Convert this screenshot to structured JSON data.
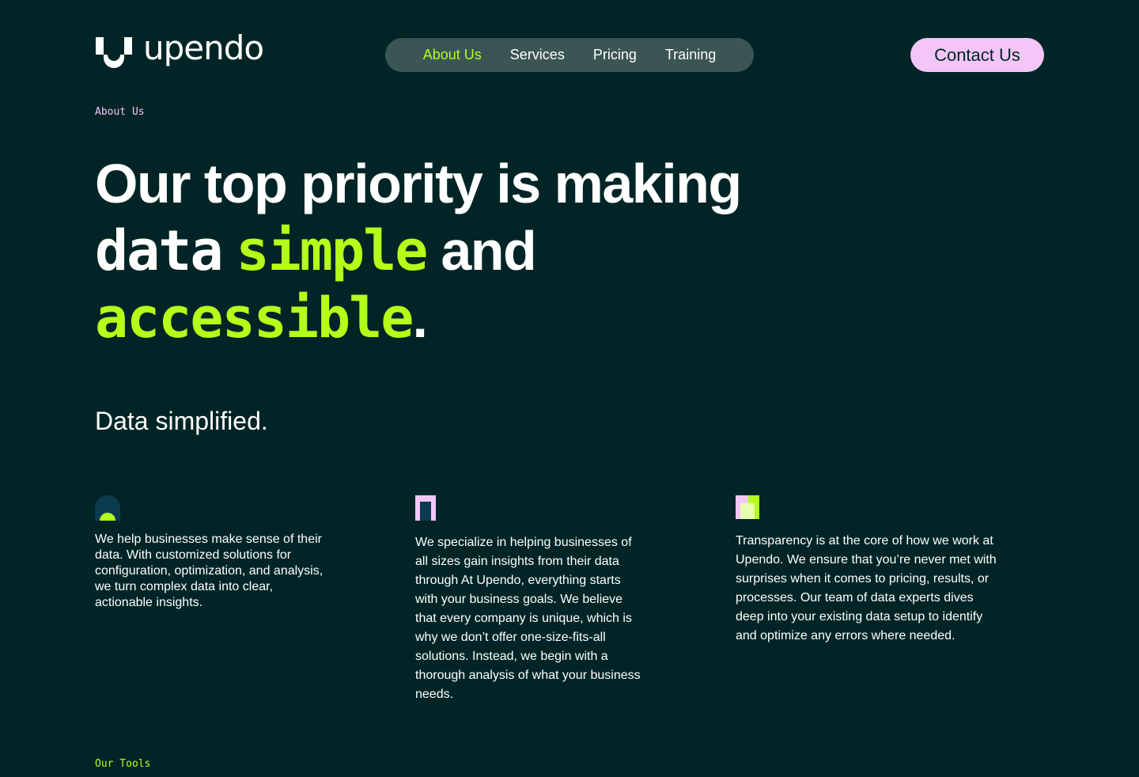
{
  "brand": {
    "name": "upendo",
    "logo_icon": "upendo-u-mark-icon"
  },
  "nav": {
    "items": [
      {
        "label": "About Us",
        "active": true
      },
      {
        "label": "Services",
        "active": false
      },
      {
        "label": "Pricing",
        "active": false
      },
      {
        "label": "Training",
        "active": false
      }
    ]
  },
  "header": {
    "contact_label": "Contact Us"
  },
  "hero": {
    "eyebrow": "About Us",
    "line1": "Our top priority is making",
    "word_data": "data",
    "word_simple": "simple",
    "word_and": "and",
    "word_accessible": "accessible",
    "period": "."
  },
  "subtitle": "Data simplified.",
  "features": [
    {
      "icon": "arch-dot-icon",
      "text": "We help businesses make sense of their data. With customized solutions for configuration, optimization, and analysis, we turn complex data into clear, actionable insights."
    },
    {
      "icon": "door-frame-icon",
      "text": "We specialize in helping businesses of all sizes gain insights from their data through At Upendo, everything starts with your business goals. We believe that every company is unique, which is why we don’t offer one-size-fits-all solutions. Instead, we begin with a thorough analysis of what your business needs."
    },
    {
      "icon": "layered-squares-icon",
      "text": "Transparency is at the core of how we work at Upendo. We ensure that you’re never met with surprises when it comes to pricing, results, or processes. Our team of data experts dives deep into your existing data setup to identify and optimize any errors where needed."
    }
  ],
  "tools_eyebrow": "Our Tools",
  "colors": {
    "background": "#012526",
    "accent_green": "#b3ff1a",
    "accent_pink": "#f3c6f7",
    "nav_bg": "#3b5554",
    "icon_dark": "#0d3a4d"
  }
}
